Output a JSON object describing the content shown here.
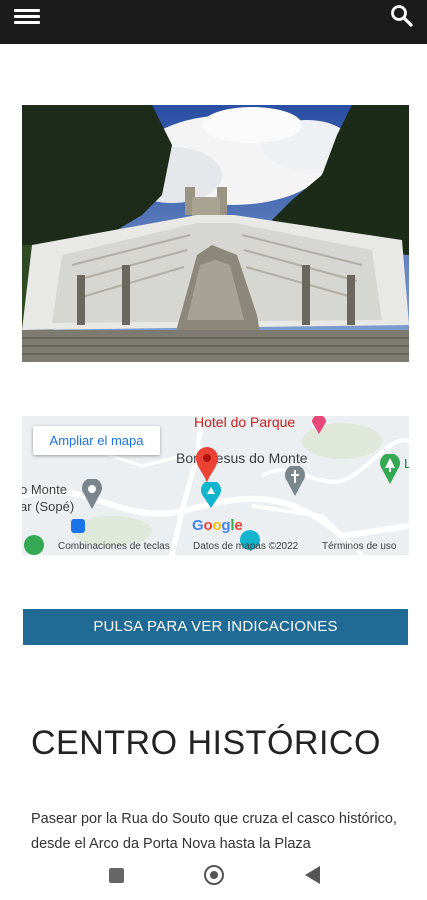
{
  "header": {
    "menu_icon": "hamburger-menu-icon",
    "search_icon": "search-icon"
  },
  "hero_image": {
    "icon": "bom-jesus-staircase-photo"
  },
  "map": {
    "expand_label": "Ampliar el mapa",
    "hotel_label": "Hotel do Parque",
    "place_label": "Bom Jesus do Monte",
    "left_label_1": "o Monte",
    "left_label_2": "ar (Sopé)",
    "right_label": "L",
    "google_label": "Google",
    "footer": {
      "shortcuts": "Combinaciones de teclas",
      "data": "Datos de mapas ©2022",
      "terms": "Términos de uso"
    },
    "colors": {
      "pin": "#ea4335",
      "road": "#ffffff",
      "park": "#34a853",
      "transit": "#1a73e8"
    }
  },
  "cta": {
    "label": "PULSA PARA VER INDICACIONES",
    "color": "#206a96"
  },
  "section": {
    "title": "CENTRO HISTÓRICO",
    "paragraph": "Pasear por la Rua do Souto que cruza el casco histórico, desde el Arco da Porta Nova hasta la Plaza"
  },
  "system_nav": {
    "recents_icon": "square-recents-icon",
    "home_icon": "circle-home-icon",
    "back_icon": "triangle-back-icon"
  }
}
